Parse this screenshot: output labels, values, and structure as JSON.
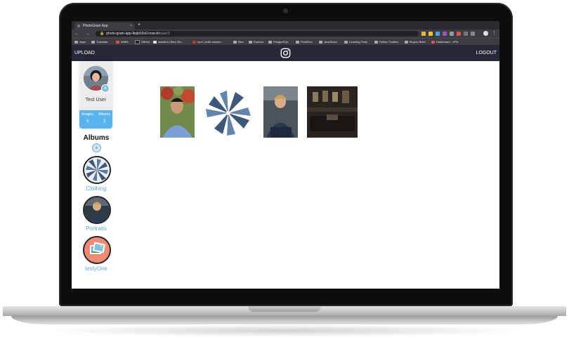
{
  "browser": {
    "tab_title": "PhotoGram App",
    "tab_close": "×",
    "new_tab": "+",
    "url_host": "photo-gram-app-lkqbt16v0.now.sh",
    "url_path": "/user/1",
    "lock_glyph": "🔒",
    "nav_glyphs": "← → C",
    "menu_glyph": "⋮",
    "bookmarks": [
      "Apps",
      "Translate",
      "Netflix",
      "GitHub",
      "slackbot | Bloc Stu...",
      "npm | build amazin...",
      "Bloc",
      "Express",
      "PostgreSQL",
      "FrontEnd",
      "JavaScript",
      "Learning Tools",
      "Python Toolbox",
      "Bequia Build",
      "Dashboard - VPN"
    ]
  },
  "app": {
    "upload_label": "UPLOAD",
    "logout_label": "LOGOUT",
    "logo_icon": "instagram-icon"
  },
  "profile": {
    "name": "Test User",
    "add_glyph": "+",
    "images_label": "Images",
    "images_count": "4",
    "albums_label": "Albums",
    "albums_count": "3"
  },
  "albums": {
    "title": "Albums",
    "add_glyph": "+",
    "items": [
      {
        "label": "Clothing"
      },
      {
        "label": "Portraits"
      },
      {
        "label": "testyOne"
      }
    ]
  },
  "gallery": {
    "photos": [
      "man-in-blue-shirt-photo",
      "jeans-pinwheel-photo",
      "seated-man-portrait-photo",
      "dark-interior-photo"
    ]
  },
  "colors": {
    "nav_bg": "#252836",
    "stats_bg": "#58b4ee",
    "album_label": "#59a9e0"
  }
}
